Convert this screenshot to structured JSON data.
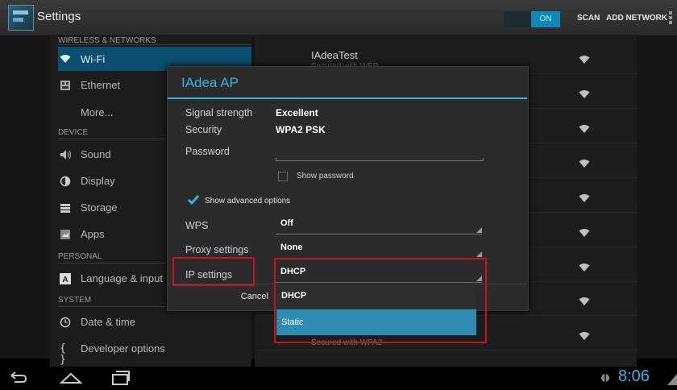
{
  "action_bar": {
    "title": "Settings",
    "toggle_state": "ON",
    "scan_label": "SCAN",
    "add_network_label": "ADD NETWORK"
  },
  "sidebar": {
    "items": [
      {
        "type": "header",
        "label": "WIRELESS & NETWORKS"
      },
      {
        "type": "item",
        "icon": "wifi-icon",
        "label": "Wi-Fi",
        "selected": true
      },
      {
        "type": "item",
        "icon": "ethernet-icon",
        "label": "Ethernet"
      },
      {
        "type": "item",
        "icon": "",
        "label": "More..."
      },
      {
        "type": "header",
        "label": "DEVICE"
      },
      {
        "type": "item",
        "icon": "sound-icon",
        "label": "Sound"
      },
      {
        "type": "item",
        "icon": "display-icon",
        "label": "Display"
      },
      {
        "type": "item",
        "icon": "storage-icon",
        "label": "Storage"
      },
      {
        "type": "item",
        "icon": "apps-icon",
        "label": "Apps"
      },
      {
        "type": "header",
        "label": "PERSONAL"
      },
      {
        "type": "item",
        "icon": "language-icon",
        "label": "Language & input"
      },
      {
        "type": "header",
        "label": "SYSTEM"
      },
      {
        "type": "item",
        "icon": "clock-icon",
        "label": "Date & time"
      },
      {
        "type": "item",
        "icon": "braces-icon",
        "label": "Developer options"
      }
    ]
  },
  "networks": [
    {
      "name": "IAdeaTest",
      "status": "Secured with WEP"
    },
    {
      "name": "",
      "status": ""
    },
    {
      "name": "",
      "status": ""
    },
    {
      "name": "",
      "status": ""
    },
    {
      "name": "",
      "status": ""
    },
    {
      "name": "",
      "status": ""
    },
    {
      "name": "",
      "status": ""
    },
    {
      "name": "",
      "status": ""
    },
    {
      "name": "",
      "status": "Secured with WPA2"
    }
  ],
  "dialog": {
    "title": "IAdea AP",
    "signal_label": "Signal strength",
    "signal_value": "Excellent",
    "security_label": "Security",
    "security_value": "WPA2 PSK",
    "password_label": "Password",
    "show_password_label": "Show password",
    "show_password_checked": false,
    "show_advanced_label": "Show advanced options",
    "show_advanced_checked": true,
    "wps_label": "WPS",
    "wps_value": "Off",
    "proxy_label": "Proxy settings",
    "proxy_value": "None",
    "ip_label": "IP settings",
    "ip_value": "DHCP",
    "cancel_label": "Cancel"
  },
  "ip_dropdown": {
    "options": [
      "DHCP",
      "Static"
    ],
    "highlighted": "Static"
  },
  "status_bar": {
    "time": "8:06"
  },
  "colors": {
    "accent": "#33b5e5",
    "highlight_box": "#c0161c",
    "selected_option": "#2e8bb2"
  }
}
